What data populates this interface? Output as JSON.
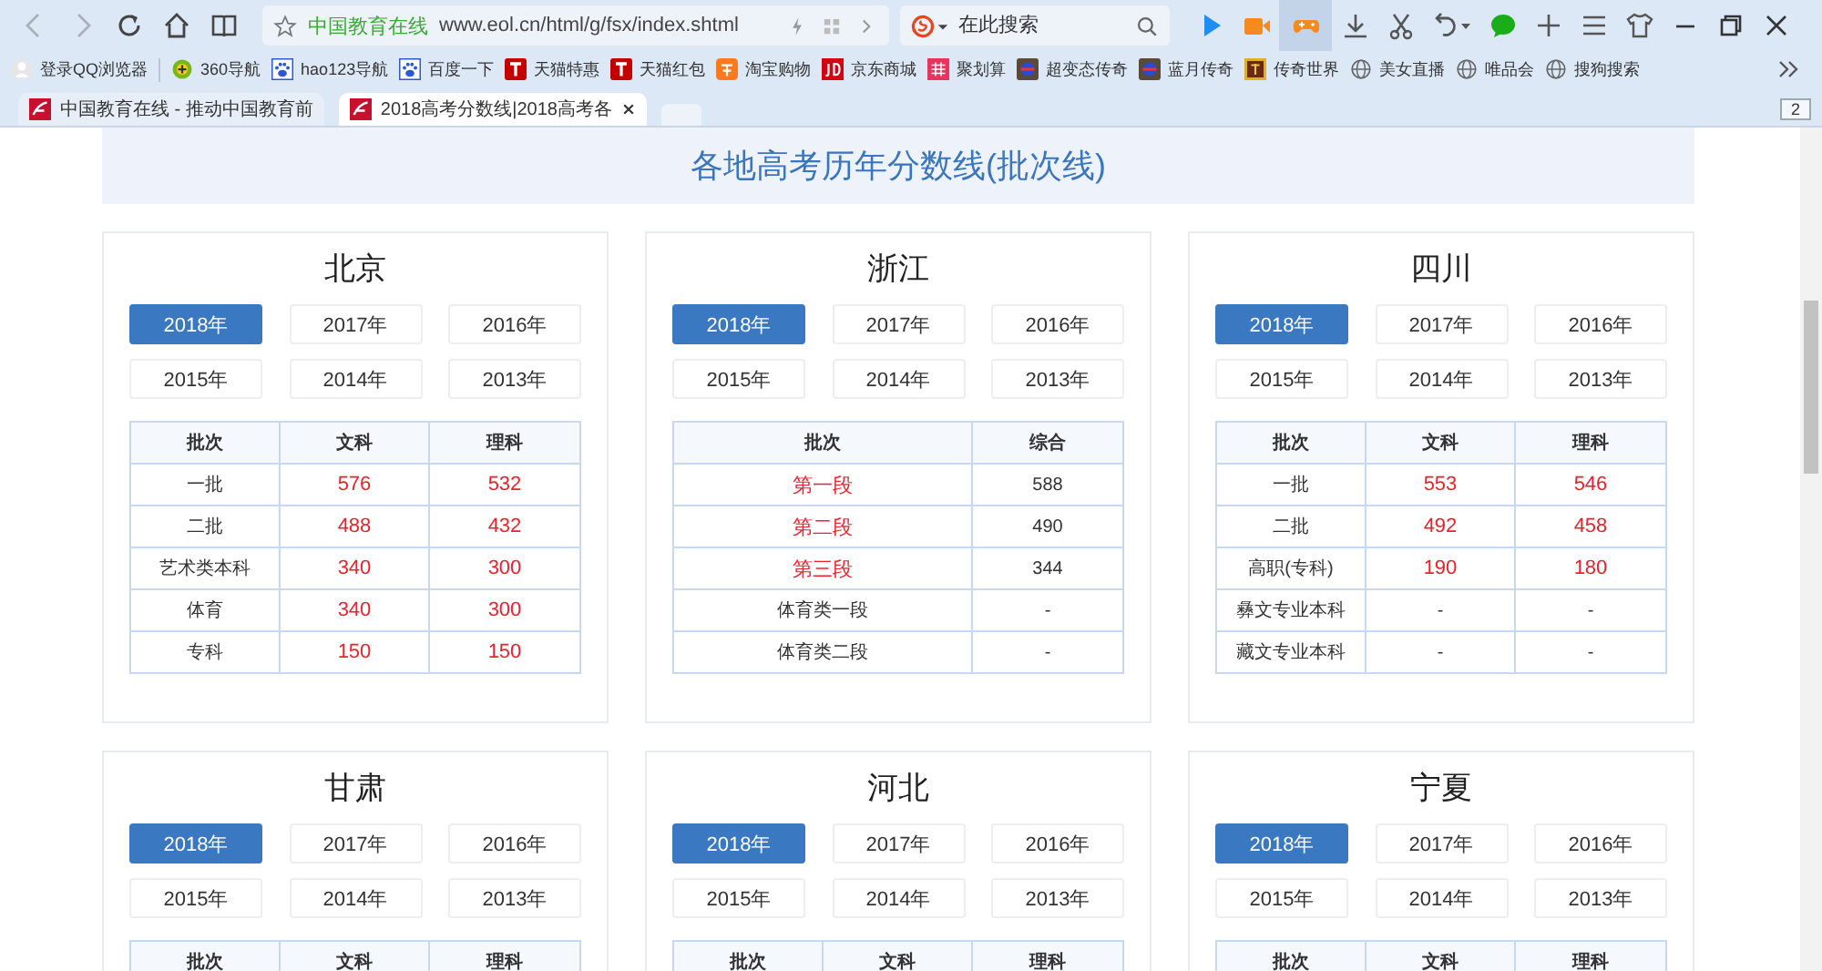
{
  "browser": {
    "address_bar": {
      "site_name": "中国教育在线",
      "url": "www.eol.cn/html/g/fsx/index.shtml"
    },
    "search": {
      "placeholder": "在此搜索"
    },
    "bookmarks": [
      {
        "label": "登录QQ浏览器",
        "kind": "avatar"
      },
      {
        "label": "360导航",
        "kind": "circle"
      },
      {
        "label": "hao123导航",
        "kind": "paw"
      },
      {
        "label": "百度一下",
        "kind": "paw"
      },
      {
        "label": "天猫特惠",
        "kind": "tmall"
      },
      {
        "label": "天猫红包",
        "kind": "tmall"
      },
      {
        "label": "淘宝购物",
        "kind": "taobao"
      },
      {
        "label": "京东商城",
        "kind": "jd"
      },
      {
        "label": "聚划算",
        "kind": "pink"
      },
      {
        "label": "超变态传奇",
        "kind": "game"
      },
      {
        "label": "蓝月传奇",
        "kind": "game"
      },
      {
        "label": "传奇世界",
        "kind": "gold"
      },
      {
        "label": "美女直播",
        "kind": "globe"
      },
      {
        "label": "唯品会",
        "kind": "globe"
      },
      {
        "label": "搜狗搜索",
        "kind": "globe"
      }
    ],
    "tabs": [
      {
        "title": "中国教育在线 - 推动中国教育前",
        "selected": false
      },
      {
        "title": "2018高考分数线|2018高考各",
        "selected": true
      }
    ],
    "tab_count": "2"
  },
  "page": {
    "heading": "各地高考历年分数线(批次线)",
    "cards": [
      {
        "title": "北京",
        "years": [
          {
            "label": "2018年",
            "selected": true
          },
          {
            "label": "2017年",
            "selected": false
          },
          {
            "label": "2016年",
            "selected": false
          },
          {
            "label": "2015年",
            "selected": false
          },
          {
            "label": "2014年",
            "selected": false
          },
          {
            "label": "2013年",
            "selected": false
          }
        ],
        "columns": [
          "批次",
          "文科",
          "理科"
        ],
        "rows": [
          [
            {
              "text": "一批",
              "emphasized": false
            },
            {
              "text": "576",
              "emphasized": true
            },
            {
              "text": "532",
              "emphasized": true
            }
          ],
          [
            {
              "text": "二批",
              "emphasized": false
            },
            {
              "text": "488",
              "emphasized": true
            },
            {
              "text": "432",
              "emphasized": true
            }
          ],
          [
            {
              "text": "艺术类本科",
              "emphasized": false
            },
            {
              "text": "340",
              "emphasized": true
            },
            {
              "text": "300",
              "emphasized": true
            }
          ],
          [
            {
              "text": "体育",
              "emphasized": false
            },
            {
              "text": "340",
              "emphasized": true
            },
            {
              "text": "300",
              "emphasized": true
            }
          ],
          [
            {
              "text": "专科",
              "emphasized": false
            },
            {
              "text": "150",
              "emphasized": true
            },
            {
              "text": "150",
              "emphasized": true
            }
          ]
        ]
      },
      {
        "title": "浙江",
        "years": [
          {
            "label": "2018年",
            "selected": true
          },
          {
            "label": "2017年",
            "selected": false
          },
          {
            "label": "2016年",
            "selected": false
          },
          {
            "label": "2015年",
            "selected": false
          },
          {
            "label": "2014年",
            "selected": false
          },
          {
            "label": "2013年",
            "selected": false
          }
        ],
        "columns": [
          "批次",
          "综合"
        ],
        "rows": [
          [
            {
              "text": "第一段",
              "emphasized": true
            },
            {
              "text": "588",
              "emphasized": false
            }
          ],
          [
            {
              "text": "第二段",
              "emphasized": true
            },
            {
              "text": "490",
              "emphasized": false
            }
          ],
          [
            {
              "text": "第三段",
              "emphasized": true
            },
            {
              "text": "344",
              "emphasized": false
            }
          ],
          [
            {
              "text": "体育类一段",
              "emphasized": false
            },
            {
              "text": "-",
              "emphasized": false
            }
          ],
          [
            {
              "text": "体育类二段",
              "emphasized": false
            },
            {
              "text": "-",
              "emphasized": false
            }
          ]
        ]
      },
      {
        "title": "四川",
        "years": [
          {
            "label": "2018年",
            "selected": true
          },
          {
            "label": "2017年",
            "selected": false
          },
          {
            "label": "2016年",
            "selected": false
          },
          {
            "label": "2015年",
            "selected": false
          },
          {
            "label": "2014年",
            "selected": false
          },
          {
            "label": "2013年",
            "selected": false
          }
        ],
        "columns": [
          "批次",
          "文科",
          "理科"
        ],
        "rows": [
          [
            {
              "text": "一批",
              "emphasized": false
            },
            {
              "text": "553",
              "emphasized": true
            },
            {
              "text": "546",
              "emphasized": true
            }
          ],
          [
            {
              "text": "二批",
              "emphasized": false
            },
            {
              "text": "492",
              "emphasized": true
            },
            {
              "text": "458",
              "emphasized": true
            }
          ],
          [
            {
              "text": "高职(专科)",
              "emphasized": false
            },
            {
              "text": "190",
              "emphasized": true
            },
            {
              "text": "180",
              "emphasized": true
            }
          ],
          [
            {
              "text": "彝文专业本科",
              "emphasized": false
            },
            {
              "text": "-",
              "emphasized": false
            },
            {
              "text": "-",
              "emphasized": false
            }
          ],
          [
            {
              "text": "藏文专业本科",
              "emphasized": false
            },
            {
              "text": "-",
              "emphasized": false
            },
            {
              "text": "-",
              "emphasized": false
            }
          ]
        ]
      },
      {
        "title": "甘肃",
        "years": [
          {
            "label": "2018年",
            "selected": true
          },
          {
            "label": "2017年",
            "selected": false
          },
          {
            "label": "2016年",
            "selected": false
          },
          {
            "label": "2015年",
            "selected": false
          },
          {
            "label": "2014年",
            "selected": false
          },
          {
            "label": "2013年",
            "selected": false
          }
        ],
        "columns": [
          "批次",
          "文科",
          "理科"
        ]
      },
      {
        "title": "河北",
        "years": [
          {
            "label": "2018年",
            "selected": true
          },
          {
            "label": "2017年",
            "selected": false
          },
          {
            "label": "2016年",
            "selected": false
          },
          {
            "label": "2015年",
            "selected": false
          },
          {
            "label": "2014年",
            "selected": false
          },
          {
            "label": "2013年",
            "selected": false
          }
        ],
        "columns": [
          "批次",
          "文科",
          "理科"
        ]
      },
      {
        "title": "宁夏",
        "years": [
          {
            "label": "2018年",
            "selected": true
          },
          {
            "label": "2017年",
            "selected": false
          },
          {
            "label": "2016年",
            "selected": false
          },
          {
            "label": "2015年",
            "selected": false
          },
          {
            "label": "2014年",
            "selected": false
          },
          {
            "label": "2013年",
            "selected": false
          }
        ],
        "columns": [
          "批次",
          "文科",
          "理科"
        ]
      }
    ]
  }
}
